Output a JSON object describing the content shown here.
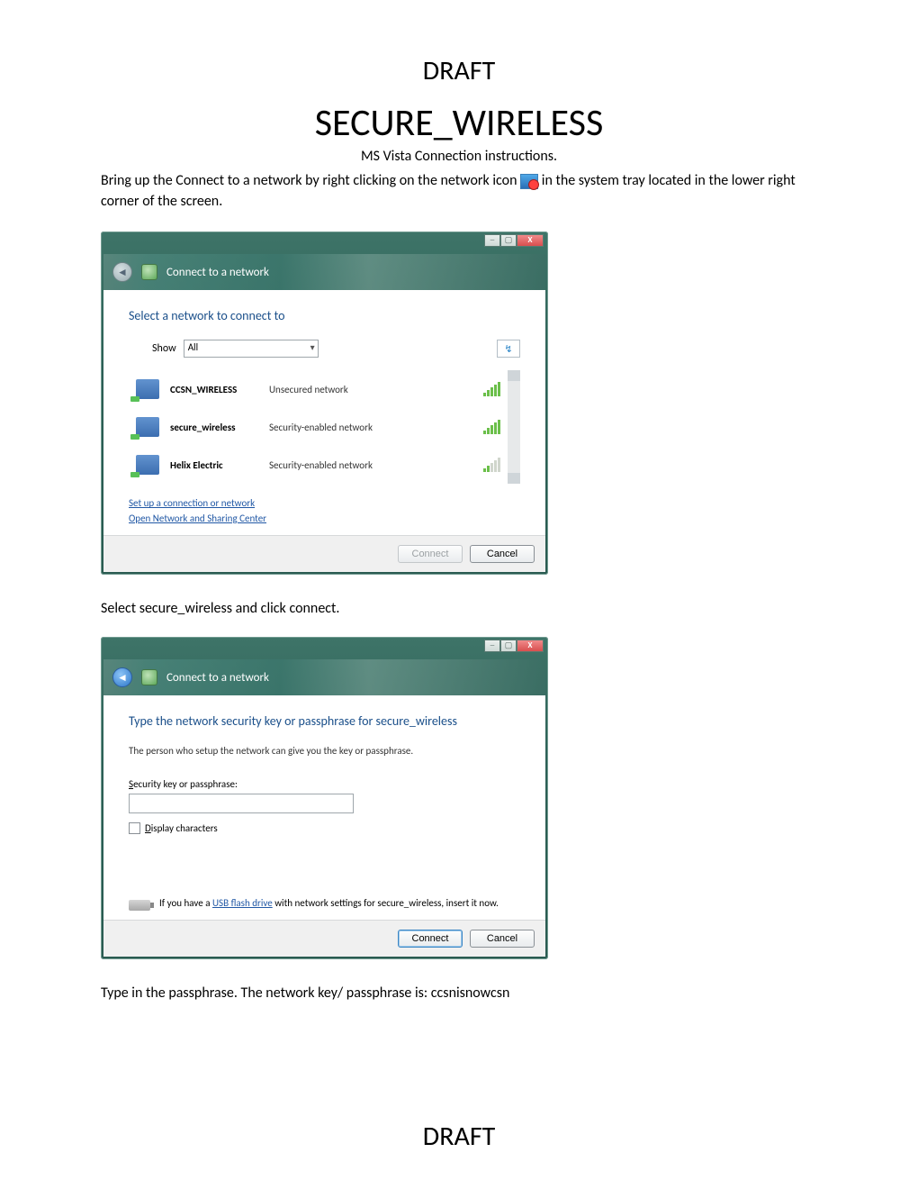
{
  "headerDraft": "DRAFT",
  "footerDraft": "DRAFT",
  "title": "SECURE_WIRELESS",
  "subtitle": "MS Vista Connection instructions.",
  "intro_pre": "Bring up the Connect to a network by right clicking on the network icon",
  "intro_post": " in the system tray located in the lower right corner of the screen.",
  "window1": {
    "title": "Connect to a network",
    "heading": "Select a network to connect to",
    "showLabel": "Show",
    "showValue": "All",
    "networks": [
      {
        "name": "CCSN_WIRELESS",
        "type": "Unsecured network",
        "strength": "strong"
      },
      {
        "name": "secure_wireless",
        "type": "Security-enabled network",
        "strength": "strong"
      },
      {
        "name": "Helix Electric",
        "type": "Security-enabled network",
        "strength": "weak"
      }
    ],
    "link1": "Set up a connection or network",
    "link2": "Open Network and Sharing Center",
    "connect": "Connect",
    "cancel": "Cancel"
  },
  "step2": "Select secure_wireless and click connect.",
  "window2": {
    "title": "Connect to a network",
    "heading": "Type the network security key or passphrase for secure_wireless",
    "desc": "The person who setup the network can give you the key or passphrase.",
    "fieldLabelPrefix": "S",
    "fieldLabelRest": "ecurity key or passphrase:",
    "displayPrefix": "D",
    "displayRest": "isplay characters",
    "usbPre": "If you have a ",
    "usbLink": "USB flash drive",
    "usbPost": " with network settings for secure_wireless, insert it now.",
    "connect": "Connect",
    "cancel": "Cancel"
  },
  "step3": "Type in the passphrase.  The network key/ passphrase is: ccsnisnowcsn"
}
